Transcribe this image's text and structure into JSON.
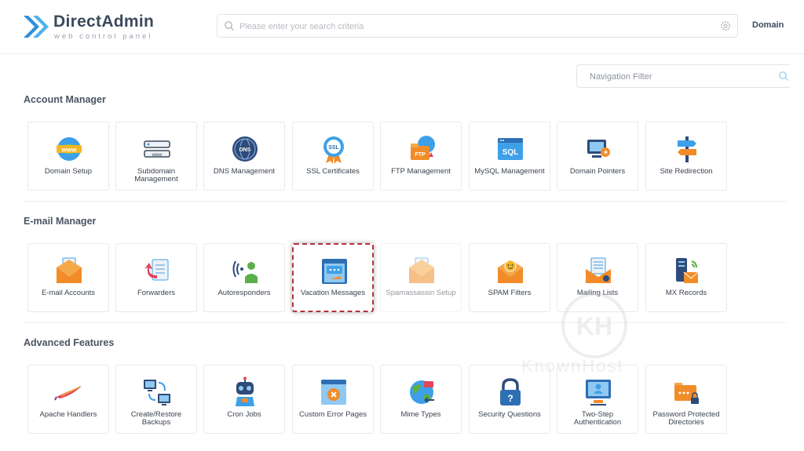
{
  "header": {
    "brand": "DirectAdmin",
    "brand_sub": "web control panel",
    "search_placeholder": "Please enter your search criteria",
    "domain_label": "Domain"
  },
  "nav_filter": {
    "placeholder": "Navigation Filter"
  },
  "sections": [
    {
      "title": "Account Manager",
      "items": [
        {
          "label": "Domain Setup",
          "icon": "www-globe-icon"
        },
        {
          "label": "Subdomain Management",
          "icon": "subdomain-icon"
        },
        {
          "label": "DNS Management",
          "icon": "dns-globe-icon"
        },
        {
          "label": "SSL Certificates",
          "icon": "ssl-badge-icon"
        },
        {
          "label": "FTP Management",
          "icon": "ftp-folder-icon"
        },
        {
          "label": "MySQL Management",
          "icon": "sql-window-icon"
        },
        {
          "label": "Domain Pointers",
          "icon": "domain-pointer-icon"
        },
        {
          "label": "Site Redirection",
          "icon": "signpost-icon"
        }
      ]
    },
    {
      "title": "E-mail Manager",
      "items": [
        {
          "label": "E-mail Accounts",
          "icon": "envelope-icon"
        },
        {
          "label": "Forwarders",
          "icon": "forward-arrow-icon"
        },
        {
          "label": "Autoresponders",
          "icon": "autoresponder-icon"
        },
        {
          "label": "Vacation Messages",
          "icon": "vacation-message-icon"
        },
        {
          "label": "Spamassassin Setup",
          "icon": "spam-envelope-icon"
        },
        {
          "label": "SPAM Filters",
          "icon": "spam-filter-icon"
        },
        {
          "label": "Mailing Lists",
          "icon": "mailing-list-icon"
        },
        {
          "label": "MX Records",
          "icon": "mx-records-icon"
        }
      ]
    },
    {
      "title": "Advanced Features",
      "items": [
        {
          "label": "Apache Handlers",
          "icon": "apache-feather-icon"
        },
        {
          "label": "Create/Restore Backups",
          "icon": "backup-icon"
        },
        {
          "label": "Cron Jobs",
          "icon": "cron-robot-icon"
        },
        {
          "label": "Custom Error Pages",
          "icon": "error-page-icon"
        },
        {
          "label": "Mime Types",
          "icon": "mime-types-icon"
        },
        {
          "label": "Security Questions",
          "icon": "security-lock-icon"
        },
        {
          "label": "Two-Step Authentication",
          "icon": "two-step-auth-icon"
        },
        {
          "label": "Password Protected Directories",
          "icon": "protected-folder-icon"
        }
      ]
    }
  ],
  "watermark": {
    "text": "KnownHost",
    "initials": "KH"
  }
}
